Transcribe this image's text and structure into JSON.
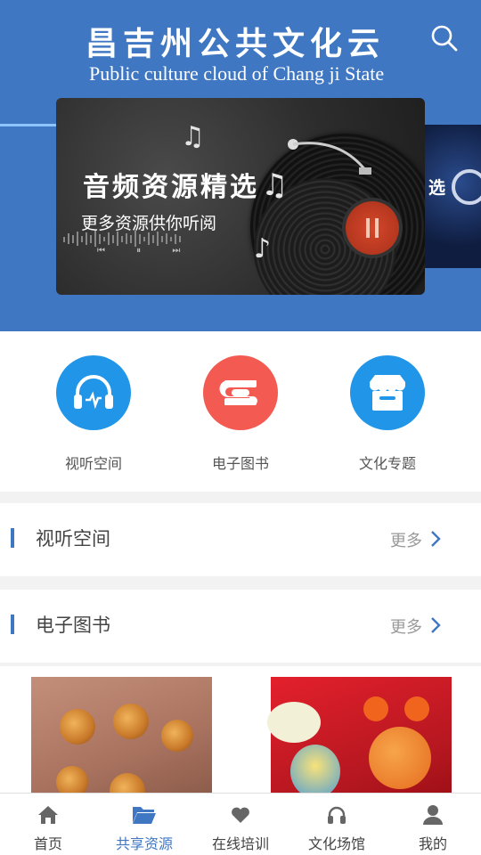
{
  "header": {
    "title_cn": "昌吉州公共文化云",
    "title_en": "Public culture cloud of Chang ji State",
    "search_icon": "search-icon"
  },
  "banner": {
    "title": "音频资源精选",
    "subtitle": "更多资源供你听阅",
    "next_slide_peek": "选"
  },
  "categories": [
    {
      "label": "视听空间",
      "icon": "headphones-icon",
      "color": "#2196e8"
    },
    {
      "label": "电子图书",
      "icon": "book-icon",
      "color": "#f25a52"
    },
    {
      "label": "文化专题",
      "icon": "store-icon",
      "color": "#2196e8"
    }
  ],
  "sections": {
    "av": {
      "title": "视听空间",
      "more": "更多"
    },
    "ebooks": {
      "title": "电子图书",
      "more": "更多"
    }
  },
  "tabbar": [
    {
      "label": "首页",
      "icon": "home-icon",
      "active": false
    },
    {
      "label": "共享资源",
      "icon": "folder-icon",
      "active": true
    },
    {
      "label": "在线培训",
      "icon": "heart-icon",
      "active": false
    },
    {
      "label": "文化场馆",
      "icon": "headphones-icon",
      "active": false
    },
    {
      "label": "我的",
      "icon": "user-icon",
      "active": false
    }
  ],
  "colors": {
    "primary": "#3f77c3",
    "accent_red": "#f25a52",
    "accent_blue": "#2196e8"
  }
}
